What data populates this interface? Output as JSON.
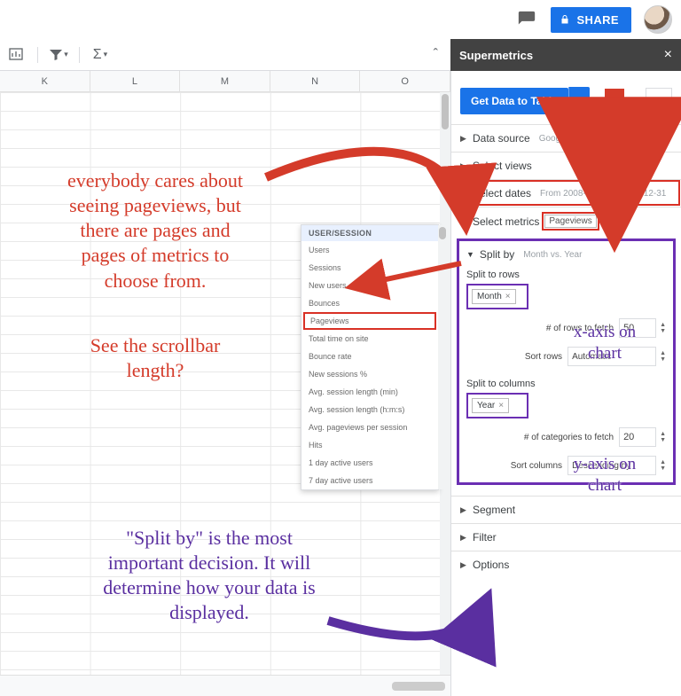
{
  "topbar": {
    "share": "SHARE"
  },
  "toolbar": {
    "sigma": "Σ"
  },
  "side_head": {
    "title": "Supermetrics",
    "close": "×"
  },
  "columns": [
    "K",
    "L",
    "M",
    "N",
    "O"
  ],
  "dropdown": {
    "header": "USER/SESSION",
    "items": [
      "Users",
      "Sessions",
      "New users",
      "Bounces",
      "Pageviews",
      "Total time on site",
      "Bounce rate",
      "New sessions %",
      "Avg. session length (min)",
      "Avg. session length (h:m:s)",
      "Avg. pageviews per session",
      "Hits",
      "1 day active users",
      "7 day active users"
    ],
    "selected_index": 4
  },
  "sidebar": {
    "get_btn": "Get Data to Table",
    "burger_caret": "▾",
    "rows": {
      "data_source": {
        "title": "Data source",
        "sub": "Google Analytics: bwhiston@gmai..."
      },
      "select_views": {
        "title": "Select views",
        "sub": ""
      },
      "select_dates": {
        "title": "Select dates",
        "sub": "From 2008-01-01 to 2018-12-31"
      },
      "select_metrics": {
        "title": "Select metrics",
        "chip": "Pageviews"
      },
      "segment": {
        "title": "Segment"
      },
      "filter": {
        "title": "Filter"
      },
      "options": {
        "title": "Options"
      }
    },
    "split": {
      "title": "Split by",
      "sub": "Month vs. Year",
      "rows_label": "Split to rows",
      "rows_token": "Month",
      "rows_fetch_label": "# of rows to fetch",
      "rows_fetch_value": "50",
      "rows_sort_label": "Sort rows",
      "rows_sort_value": "Automatic",
      "cols_label": "Split to columns",
      "cols_token": "Year",
      "cols_fetch_label": "# of categories to fetch",
      "cols_fetch_value": "20",
      "cols_sort_label": "Sort columns",
      "cols_sort_value": "Descending by"
    }
  },
  "annotations": {
    "a1": "everybody cares about\nseeing pageviews, but\nthere are pages and\npages of metrics to\nchoose from.",
    "a2": "See the scrollbar\nlength?",
    "a3": "\"Split by\" is the most\nimportant decision. It will\ndetermine how your data is\ndisplayed.",
    "a4": "x-axis on\nchart",
    "a5": "y-axis on\nchart"
  }
}
